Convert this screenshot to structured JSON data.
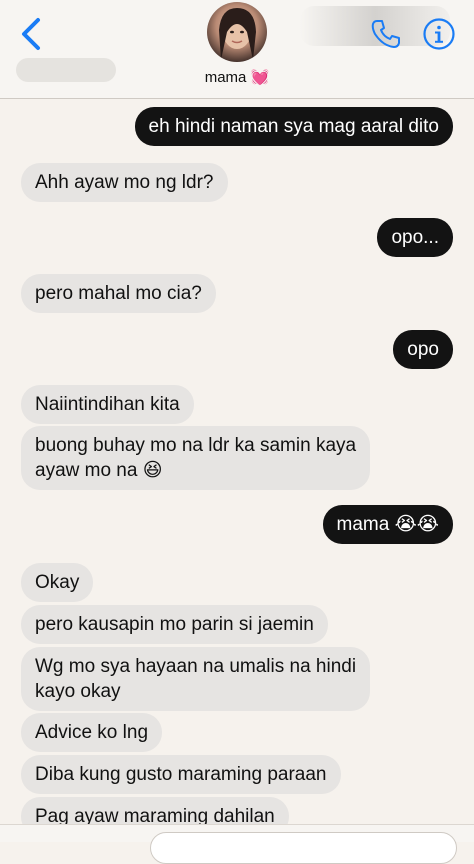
{
  "header": {
    "contact_name": "mama",
    "contact_emoji": "💓"
  },
  "messages": [
    {
      "dir": "out",
      "text": "eh hindi naman sya mag aaral dito"
    },
    {
      "dir": "in",
      "text": "Ahh ayaw mo ng ldr?"
    },
    {
      "dir": "out",
      "text": "opo..."
    },
    {
      "dir": "in",
      "text": "pero mahal mo cia?"
    },
    {
      "dir": "out",
      "text": "opo"
    },
    {
      "dir": "in",
      "text": "Naiintindihan kita"
    },
    {
      "dir": "in",
      "text": "buong buhay mo na ldr ka samin kaya",
      "text2": "ayaw mo na 😆"
    },
    {
      "dir": "out",
      "text": "mama 😭😭"
    },
    {
      "dir": "in",
      "text": "Okay"
    },
    {
      "dir": "in",
      "text": "pero kausapin mo parin si jaemin"
    },
    {
      "dir": "in",
      "text": "Wg mo sya hayaan na umalis na hindi",
      "text2": "kayo okay"
    },
    {
      "dir": "in",
      "text": "Advice ko lng"
    },
    {
      "dir": "in",
      "text": "Diba kung gusto maraming paraan"
    },
    {
      "dir": "in",
      "text": "Pag ayaw maraming dahilan"
    }
  ],
  "icons": {
    "back": "chevron-left-icon",
    "phone": "phone-icon",
    "info": "info-icon"
  },
  "colors": {
    "accent": "#1a7cf5",
    "outgoing_bubble": "#131313",
    "incoming_bubble": "#e6e4e2",
    "background": "#f6f2ed"
  }
}
